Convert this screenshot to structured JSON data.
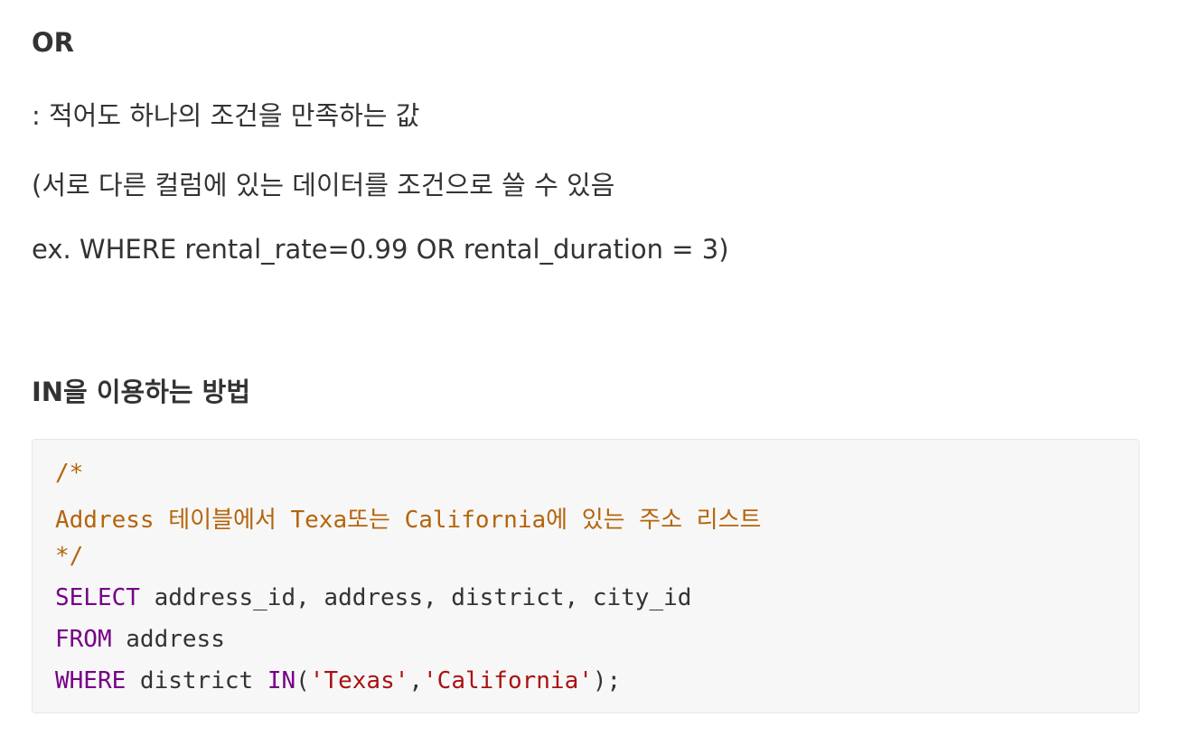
{
  "heading_or": "OR",
  "or_desc": ": 적어도 하나의 조건을 만족하는 값",
  "or_note": "(서로 다른 컬럼에 있는 데이터를 조건으로 쓸 수 있음",
  "or_example": "ex.  WHERE rental_rate=0.99 OR rental_duration = 3)",
  "heading_in": "IN을 이용하는 방법",
  "code": {
    "comment_open": "/*",
    "comment_text": "Address 테이블에서 Texa또는 California에 있는 주소 리스트",
    "comment_close": "*/",
    "line4_keyword": "SELECT",
    "line4_rest": " address_id, address, district, city_id",
    "line5_keyword": "FROM",
    "line5_rest": " address",
    "line6_keyword": "WHERE",
    "line6_mid": " district ",
    "line6_in": "IN",
    "line6_paren_open": "(",
    "line6_str1": "'Texas'",
    "line6_comma": ",",
    "line6_str2": "'California'",
    "line6_end": ");"
  }
}
